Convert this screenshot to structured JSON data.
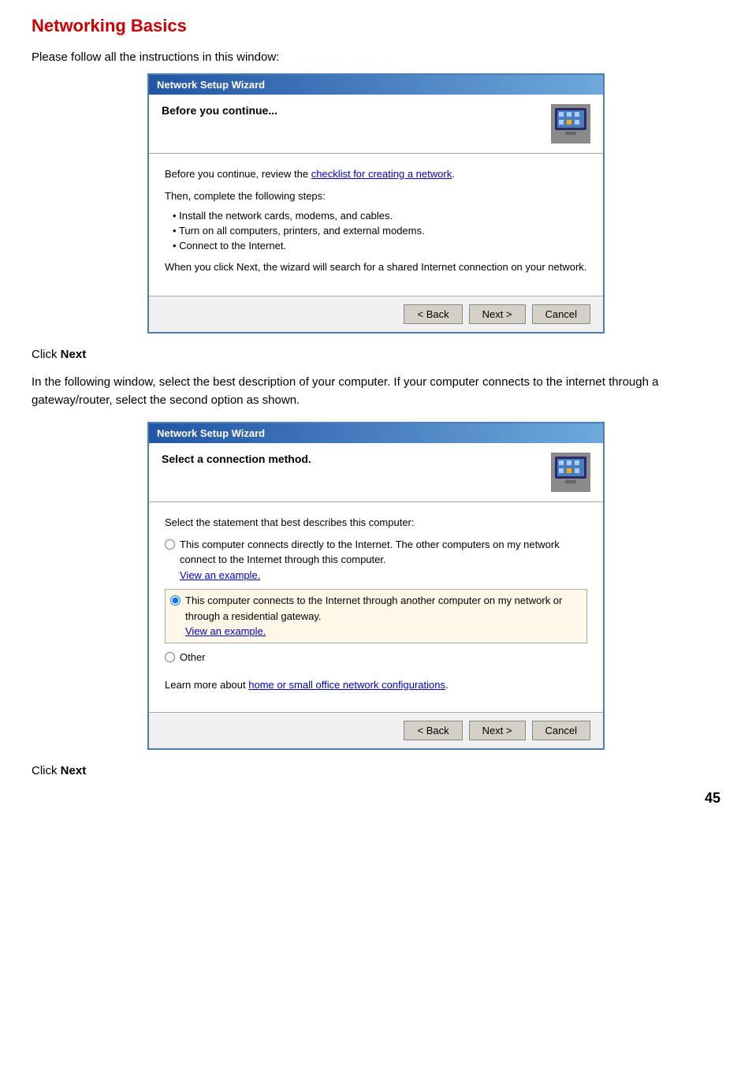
{
  "page": {
    "title": "Networking Basics",
    "page_number": "45",
    "intro_text": "Please follow all the instructions in this window:"
  },
  "wizard1": {
    "titlebar": "Network Setup Wizard",
    "header_title": "Before you continue...",
    "body": {
      "line1_pre": "Before you continue, review the ",
      "line1_link": "checklist for creating a network",
      "line1_post": ".",
      "line2": "Then, complete the following steps:",
      "steps": [
        "Install the network cards, modems, and cables.",
        "Turn on all computers, printers, and external modems.",
        "Connect to the Internet."
      ],
      "line3": "When you click Next, the wizard will search for a shared Internet connection on your network."
    },
    "footer": {
      "back_label": "< Back",
      "next_label": "Next >",
      "cancel_label": "Cancel"
    }
  },
  "click_next_1": "Click Next",
  "middle_text": "In the following window, select the best description of your computer.  If your computer connects to the internet through a gateway/router, select the second option as shown.",
  "wizard2": {
    "titlebar": "Network Setup Wizard",
    "header_title": "Select a connection method.",
    "body": {
      "intro": "Select the statement that best describes this computer:",
      "option1": {
        "text": "This computer connects directly to the Internet. The other computers on my network connect to the Internet through this computer.",
        "link": "View an example.",
        "selected": false
      },
      "option2": {
        "text": "This computer connects to the Internet through another computer on my network or through a residential gateway.",
        "link": "View an example.",
        "selected": true
      },
      "option3": {
        "text": "Other",
        "selected": false
      },
      "footer_text_pre": "Learn more about ",
      "footer_link": "home or small office network configurations",
      "footer_text_post": "."
    },
    "footer": {
      "back_label": "< Back",
      "next_label": "Next >",
      "cancel_label": "Cancel"
    }
  },
  "click_next_2": "Click Next"
}
